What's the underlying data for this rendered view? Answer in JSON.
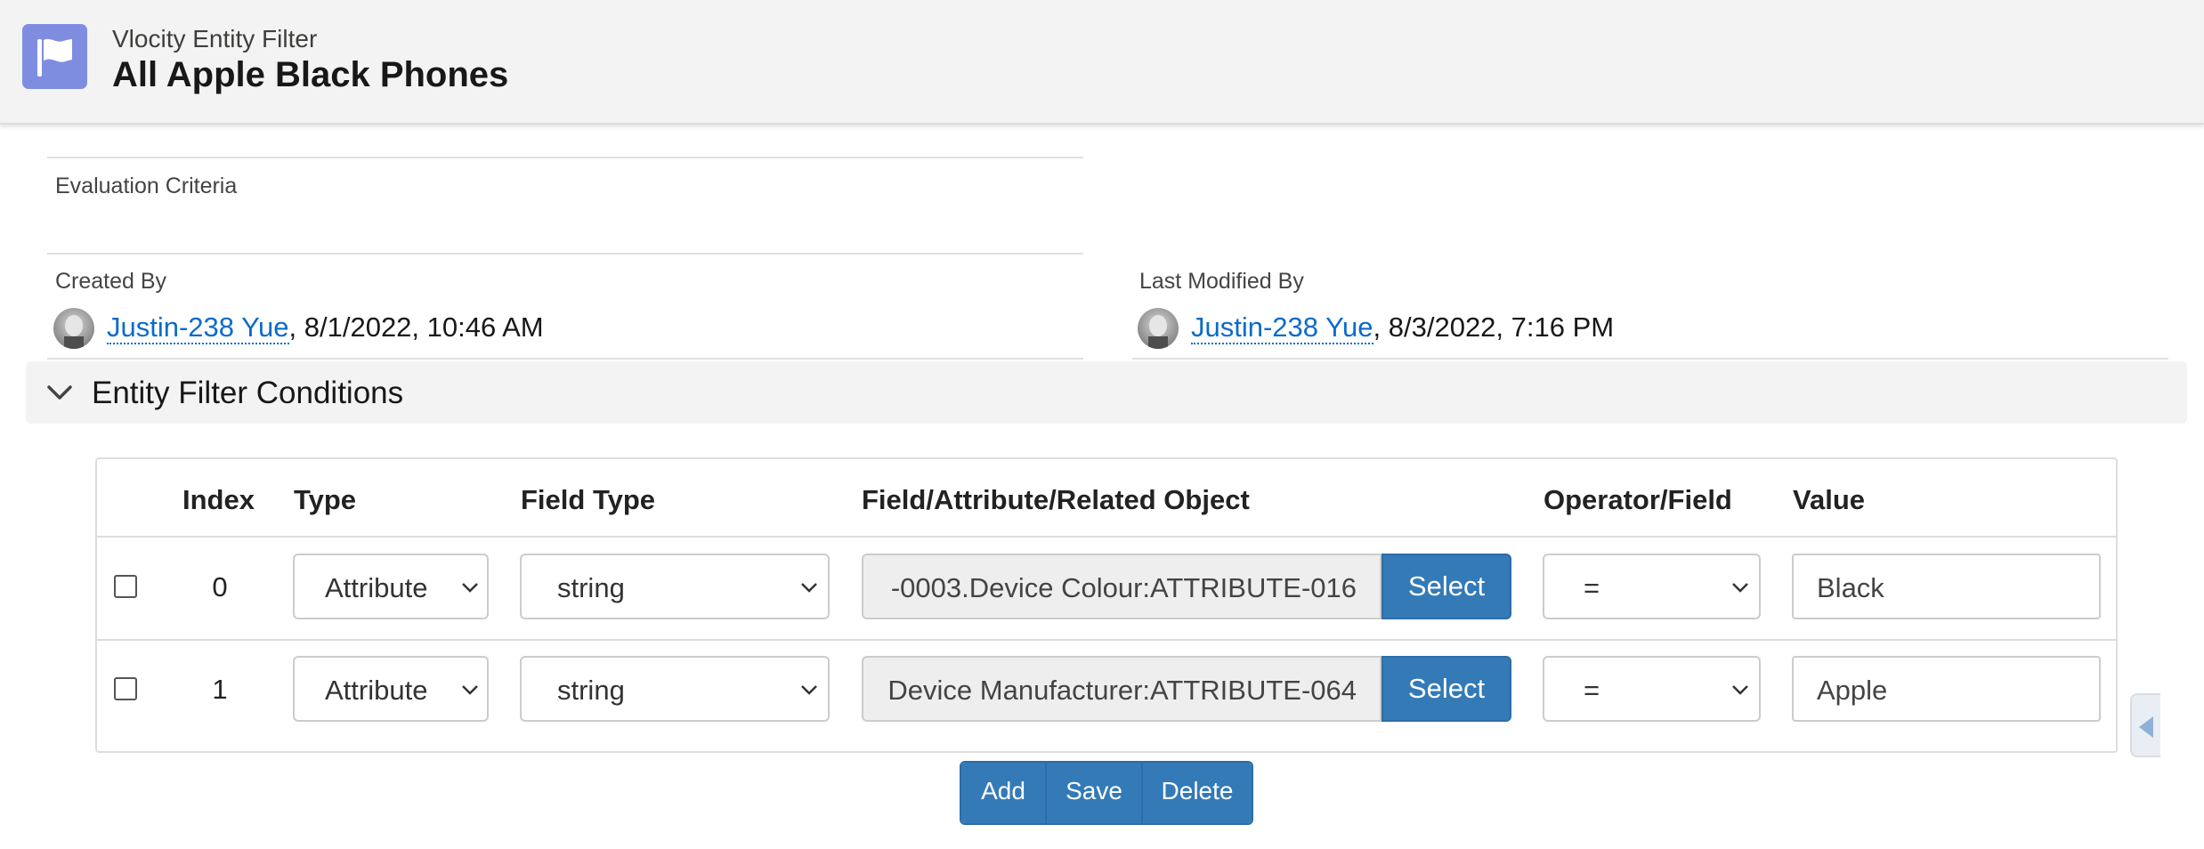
{
  "header": {
    "object_label": "Vlocity Entity Filter",
    "record_title": "All Apple Black Phones",
    "icon": "flag-icon",
    "icon_color": "#7f8de1"
  },
  "details": {
    "evaluation_criteria_label": "Evaluation Criteria",
    "evaluation_criteria_value": "",
    "created_by_label": "Created By",
    "created_by_user": "Justin-238 Yue",
    "created_by_date": ", 8/1/2022, 10:46 AM",
    "last_modified_label": "Last Modified By",
    "last_modified_user": "Justin-238 Yue",
    "last_modified_date": ", 8/3/2022, 7:16 PM"
  },
  "section": {
    "title": "Entity Filter Conditions",
    "icon": "chevron-down-icon"
  },
  "table": {
    "columns": [
      "Index",
      "Type",
      "Field Type",
      "Field/Attribute/Related Object",
      "Operator/Field",
      "Value"
    ],
    "rows": [
      {
        "index": "0",
        "type": "Attribute",
        "field_type": "string",
        "field": "-0003.Device Colour:ATTRIBUTE-016",
        "select_label": "Select",
        "operator": "=",
        "value": "Black"
      },
      {
        "index": "1",
        "type": "Attribute",
        "field_type": "string",
        "field": "Device Manufacturer:ATTRIBUTE-064",
        "select_label": "Select",
        "operator": "=",
        "value": "Apple"
      }
    ]
  },
  "actions": {
    "add_label": "Add",
    "save_label": "Save",
    "delete_label": "Delete"
  },
  "colors": {
    "link": "#0b6bc9",
    "button": "#337ab7"
  }
}
